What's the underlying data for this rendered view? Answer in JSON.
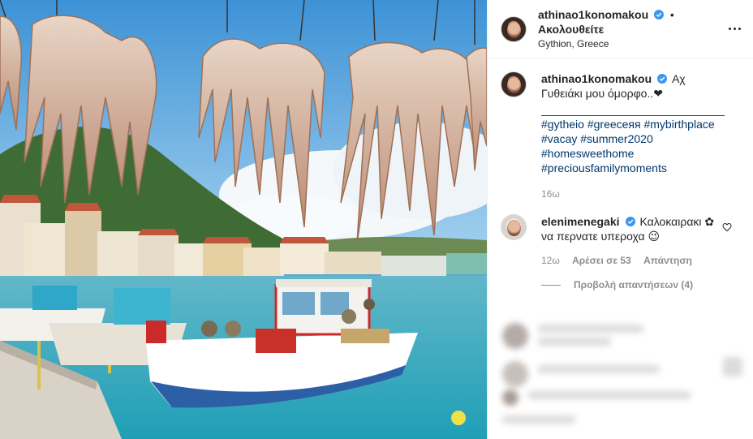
{
  "post": {
    "username": "athinao1konomakou",
    "follow_label": "Ακολουθείτε",
    "location": "Gythion, Greece"
  },
  "caption": {
    "username": "athinao1konomakou",
    "text": "Αχ Γυθειάκι μου όμορφο..❤",
    "divider": "_____________________________",
    "hashtags": [
      "#gytheio",
      "#greeceяя",
      "#mybirthplace",
      "#vacay",
      "#summer2020",
      "#homesweethome",
      "#preciousfamilymoments"
    ],
    "time": "16ω"
  },
  "comment": {
    "username": "elenimenegaki",
    "text": "Καλοκαιρακι ✿ να περνατε υπεροχα 😉",
    "time": "12ω",
    "likes": "Αρέσει σε 53",
    "reply": "Απάντηση"
  },
  "view_replies": "Προβολή απαντήσεων (4)",
  "colors": {
    "link": "#00376b",
    "verified": "#3897f0",
    "muted": "#8e8e8e"
  }
}
